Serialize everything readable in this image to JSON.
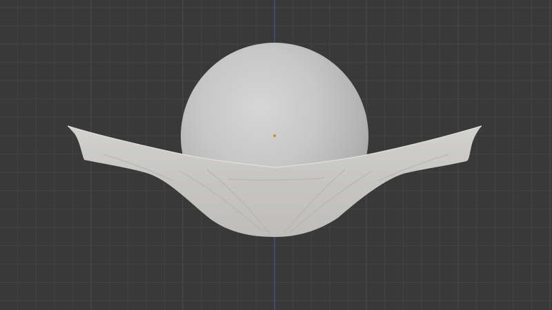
{
  "viewport": {
    "background_color": "#393939",
    "grid_minor_color": "#444444",
    "grid_major_color": "#4a4a4a",
    "axis_color": "#3f5b9e",
    "origin_marker_color": "#d4873b"
  },
  "scene": {
    "objects": [
      {
        "name": "sphere",
        "color": "#bdbdbd"
      },
      {
        "name": "cloth",
        "color": "#c9c8c4"
      }
    ]
  },
  "icons": {
    "origin": "origin-dot-icon"
  }
}
